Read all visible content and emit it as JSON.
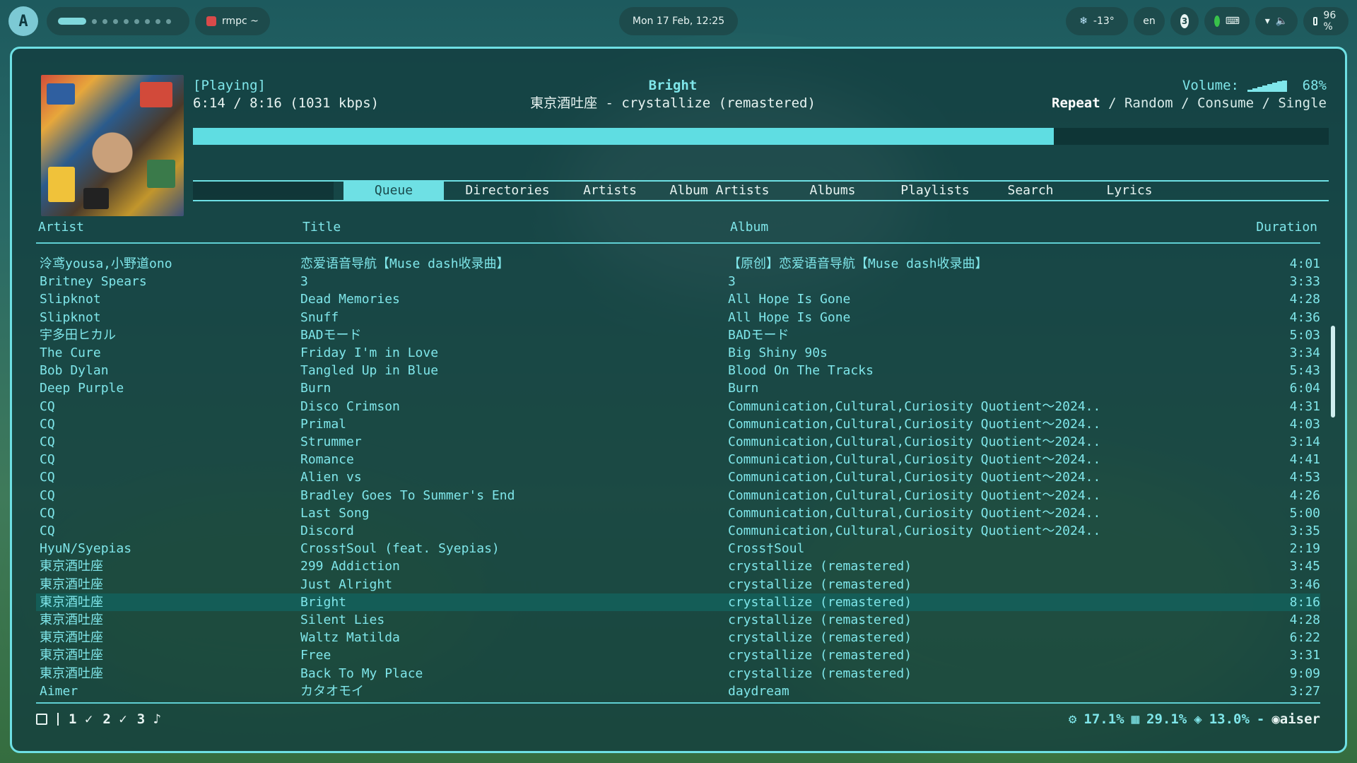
{
  "topbar": {
    "logo_glyph": "A",
    "app_label": "rmpc ~",
    "clock": "Mon 17 Feb, 12:25",
    "weather": "-13°",
    "lang": "en",
    "notif_count": "3",
    "battery": "96 %"
  },
  "player": {
    "state": "[Playing]",
    "time": "6:14 / 8:16 (1031 kbps)",
    "song": "Bright",
    "artist_album": "東京酒吐座 - crystallize (remastered)",
    "volume_label": "Volume:",
    "volume_pct": "68%",
    "progress_fraction": 0.758,
    "opt_repeat": "Repeat",
    "opt_random": "Random",
    "opt_consume": "Consume",
    "opt_single": "Single",
    "opt_sep": " / "
  },
  "tabs": {
    "queue": "Queue",
    "directories": "Directories",
    "artists": "Artists",
    "album_artists": "Album Artists",
    "albums": "Albums",
    "playlists": "Playlists",
    "search": "Search",
    "lyrics": "Lyrics"
  },
  "columns": {
    "artist": "Artist",
    "title": "Title",
    "album": "Album",
    "duration": "Duration"
  },
  "queue": [
    {
      "artist": "泠鸢yousa,小野道ono",
      "title": "恋爱语音导航【Muse dash收录曲】",
      "album": "【原创】恋爱语音导航【Muse dash收录曲】",
      "duration": "4:01"
    },
    {
      "artist": "Britney Spears",
      "title": "3",
      "album": "3",
      "duration": "3:33"
    },
    {
      "artist": "Slipknot",
      "title": "Dead Memories",
      "album": "All Hope Is Gone",
      "duration": "4:28"
    },
    {
      "artist": "Slipknot",
      "title": "Snuff",
      "album": "All Hope Is Gone",
      "duration": "4:36"
    },
    {
      "artist": "宇多田ヒカル",
      "title": "BADモード",
      "album": "BADモード",
      "duration": "5:03"
    },
    {
      "artist": "The Cure",
      "title": "Friday I'm in Love",
      "album": "Big Shiny 90s",
      "duration": "3:34"
    },
    {
      "artist": "Bob Dylan",
      "title": "Tangled Up in Blue",
      "album": "Blood On The Tracks",
      "duration": "5:43"
    },
    {
      "artist": "Deep Purple",
      "title": "Burn",
      "album": "Burn",
      "duration": "6:04"
    },
    {
      "artist": "CQ",
      "title": "Disco Crimson",
      "album": "Communication,Cultural,Curiosity Quotient～2024..",
      "duration": "4:31"
    },
    {
      "artist": "CQ",
      "title": "Primal",
      "album": "Communication,Cultural,Curiosity Quotient～2024..",
      "duration": "4:03"
    },
    {
      "artist": "CQ",
      "title": "Strummer",
      "album": "Communication,Cultural,Curiosity Quotient～2024..",
      "duration": "3:14"
    },
    {
      "artist": "CQ",
      "title": "Romance",
      "album": "Communication,Cultural,Curiosity Quotient～2024..",
      "duration": "4:41"
    },
    {
      "artist": "CQ",
      "title": "Alien vs",
      "album": "Communication,Cultural,Curiosity Quotient～2024..",
      "duration": "4:53"
    },
    {
      "artist": "CQ",
      "title": "Bradley Goes To Summer's End",
      "album": "Communication,Cultural,Curiosity Quotient～2024..",
      "duration": "4:26"
    },
    {
      "artist": "CQ",
      "title": "Last Song",
      "album": "Communication,Cultural,Curiosity Quotient～2024..",
      "duration": "5:00"
    },
    {
      "artist": "CQ",
      "title": "Discord",
      "album": "Communication,Cultural,Curiosity Quotient～2024..",
      "duration": "3:35"
    },
    {
      "artist": "HyuN/Syepias",
      "title": "Cross†Soul (feat. Syepias)",
      "album": "Cross†Soul",
      "duration": "2:19"
    },
    {
      "artist": "東京酒吐座",
      "title": "299 Addiction",
      "album": "crystallize (remastered)",
      "duration": "3:45"
    },
    {
      "artist": "東京酒吐座",
      "title": "Just Alright",
      "album": "crystallize (remastered)",
      "duration": "3:46"
    },
    {
      "artist": "東京酒吐座",
      "title": "Bright",
      "album": "crystallize (remastered)",
      "duration": "8:16",
      "current": true
    },
    {
      "artist": "東京酒吐座",
      "title": "Silent Lies",
      "album": "crystallize (remastered)",
      "duration": "4:28"
    },
    {
      "artist": "東京酒吐座",
      "title": "Waltz Matilda",
      "album": "crystallize (remastered)",
      "duration": "6:22"
    },
    {
      "artist": "東京酒吐座",
      "title": "Free",
      "album": "crystallize (remastered)",
      "duration": "3:31"
    },
    {
      "artist": "東京酒吐座",
      "title": "Back To My Place",
      "album": "crystallize (remastered)",
      "duration": "9:09"
    },
    {
      "artist": "Aimer",
      "title": "カタオモイ",
      "album": "daydream",
      "duration": "3:27"
    }
  ],
  "footer": {
    "ws1": "1",
    "ws2": "2",
    "ws3": "3",
    "cpu": "17.1%",
    "mem": "29.1%",
    "disk": "13.0%",
    "dash": "-",
    "user": "aiser"
  },
  "colors": {
    "accent": "#6ee0e4",
    "accent_text": "#7fe6ea",
    "current_row": "#145f5a"
  }
}
